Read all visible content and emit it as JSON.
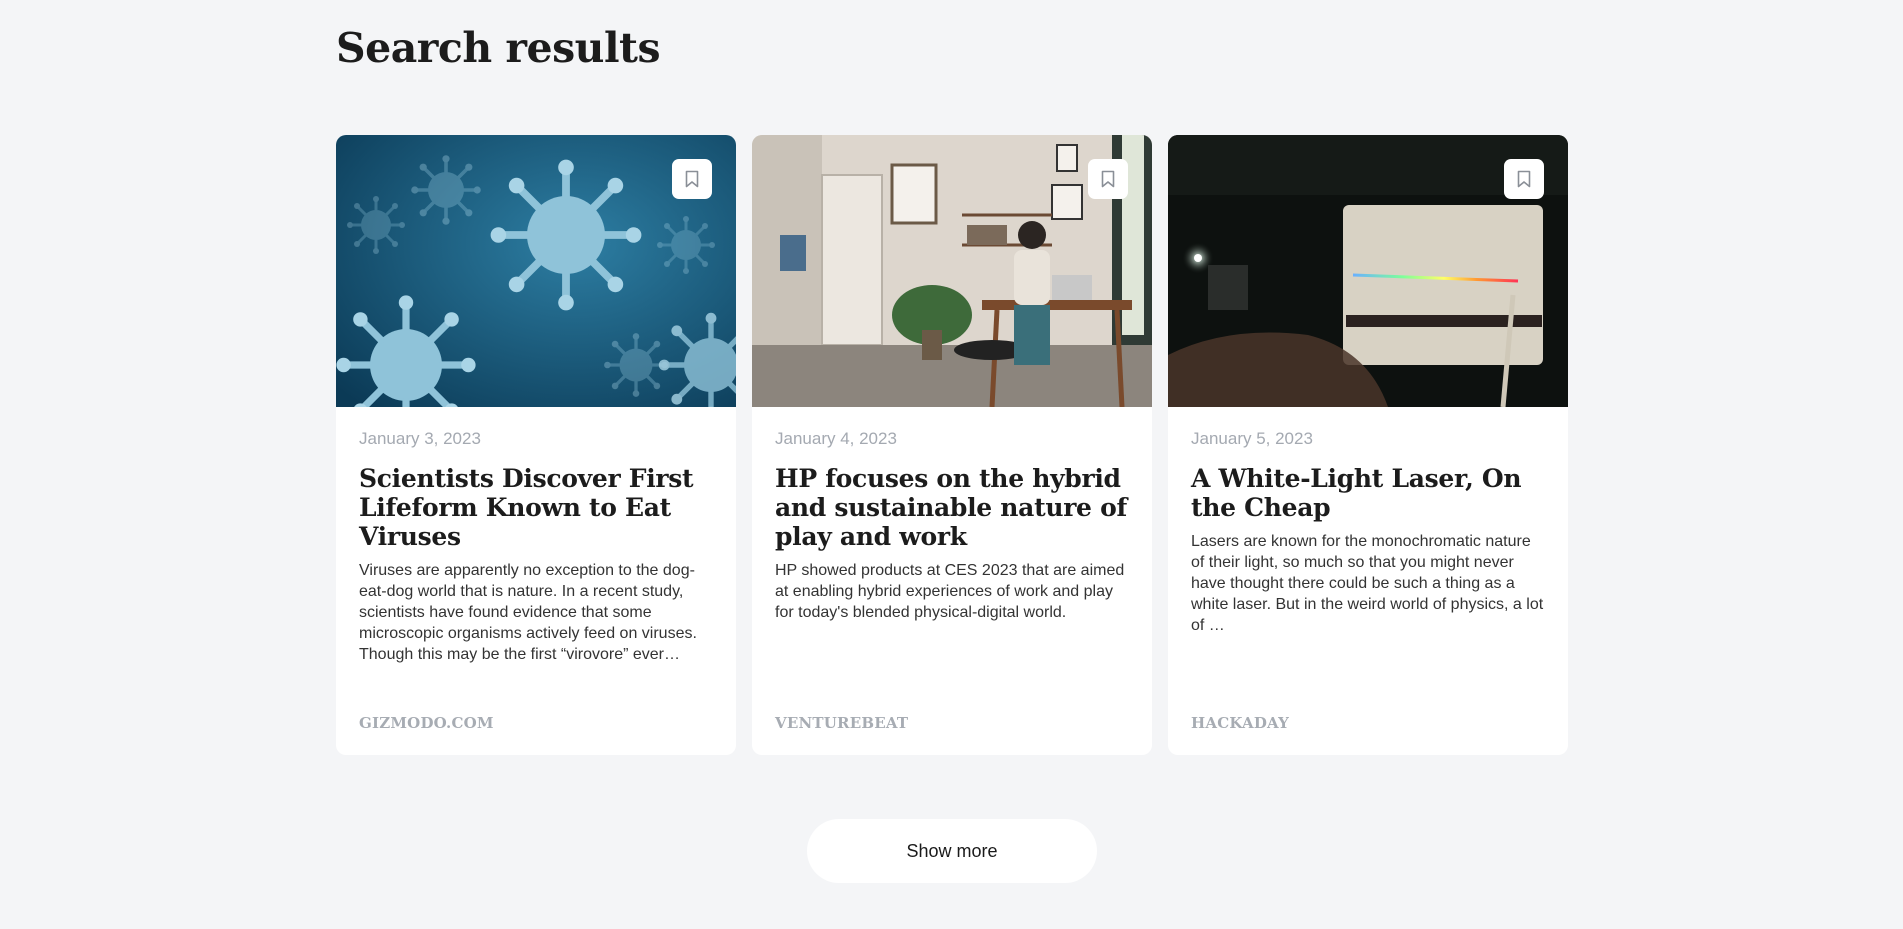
{
  "page": {
    "title": "Search results"
  },
  "results": [
    {
      "date": "January 3, 2023",
      "title": "Scientists Discover First Lifeform Known to Eat Viruses",
      "excerpt": "Viruses are apparently no exception to the dog-eat-dog world that is nature. In a recent study, scientists have found evidence that some microscopic organisms actively feed on viruses. Though this may be the first “virovore” ever…",
      "source": "GIZMODO.COM",
      "image": "virus-image",
      "bookmark_icon": "bookmark-icon"
    },
    {
      "date": "January 4, 2023",
      "title": "HP focuses on the hybrid and sustainable nature of play and work",
      "excerpt": "HP showed products at CES 2023 that are aimed at enabling hybrid experiences of work and play for today's blended physical-digital world.",
      "source": "VENTUREBEAT",
      "image": "home-office-image",
      "bookmark_icon": "bookmark-icon"
    },
    {
      "date": "January 5, 2023",
      "title": "A White-Light Laser, On the Cheap",
      "excerpt": "Lasers are known for the monochromatic nature of their light, so much so that you might never have thought there could be such a thing as a white laser. But in the weird world of physics, a lot of …",
      "source": "HACKADAY",
      "image": "laser-image",
      "bookmark_icon": "bookmark-icon"
    }
  ],
  "show_more_label": "Show more",
  "colors": {
    "background": "#f4f5f7",
    "card": "#ffffff",
    "muted_text": "#a4a9b1",
    "heading": "#1c1c1c"
  }
}
